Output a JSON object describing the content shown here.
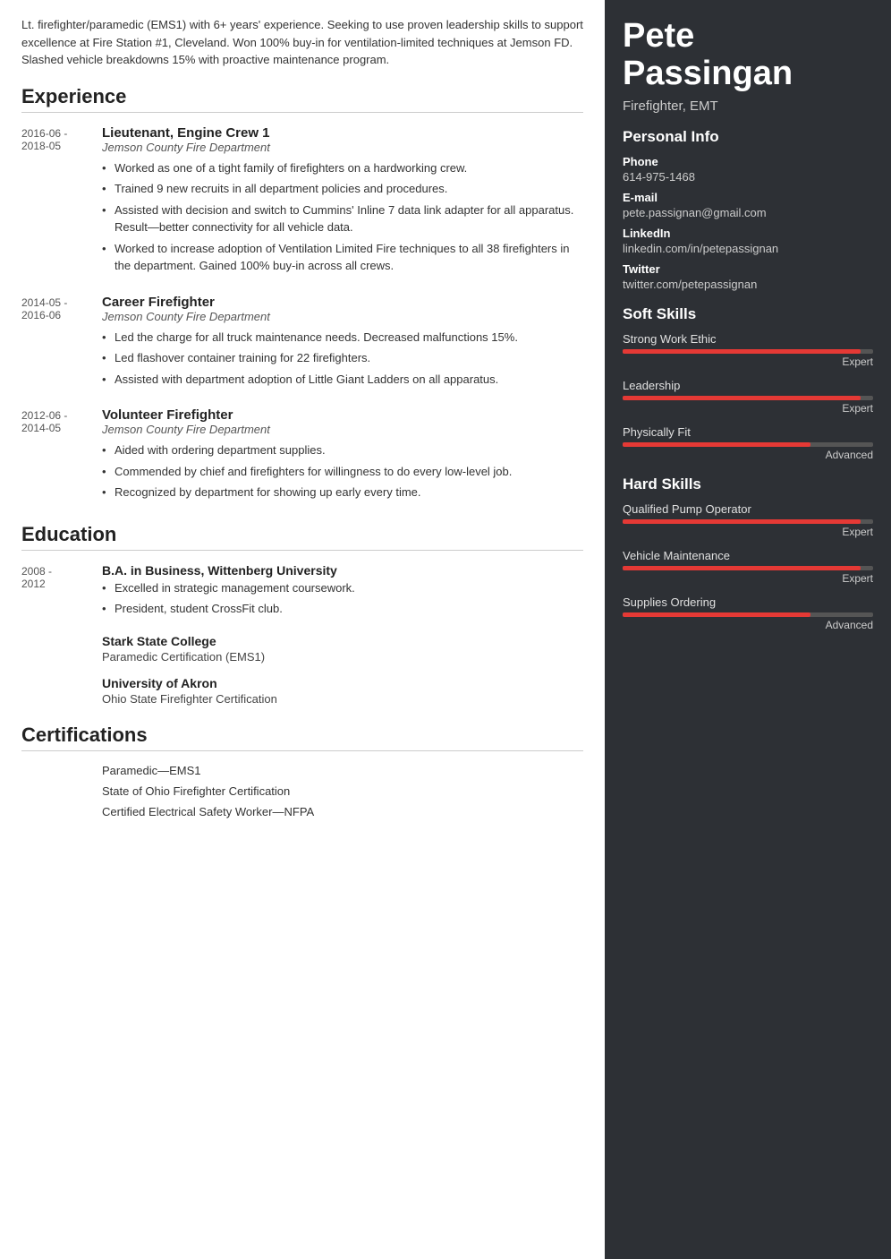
{
  "summary": "Lt. firefighter/paramedic (EMS1) with 6+ years' experience. Seeking to use proven leadership skills to support excellence at Fire Station #1, Cleveland. Won 100% buy-in for ventilation-limited techniques at Jemson FD. Slashed vehicle breakdowns 15% with proactive maintenance program.",
  "sections": {
    "experience_title": "Experience",
    "education_title": "Education",
    "certifications_title": "Certifications"
  },
  "experience": [
    {
      "dates": "2016-06 -\n2018-05",
      "title": "Lieutenant, Engine Crew 1",
      "company": "Jemson County Fire Department",
      "bullets": [
        "Worked as one of a tight family of firefighters on a hardworking crew.",
        "Trained 9 new recruits in all department policies and procedures.",
        "Assisted with decision and switch to Cummins' Inline 7 data link adapter for all apparatus. Result—better connectivity for all vehicle data.",
        "Worked to increase adoption of Ventilation Limited Fire techniques to all 38 firefighters in the department. Gained 100% buy-in across all crews."
      ]
    },
    {
      "dates": "2014-05 -\n2016-06",
      "title": "Career Firefighter",
      "company": "Jemson County Fire Department",
      "bullets": [
        "Led the charge for all truck maintenance needs. Decreased malfunctions 15%.",
        "Led flashover container training for 22 firefighters.",
        "Assisted with department adoption of Little Giant Ladders on all apparatus."
      ]
    },
    {
      "dates": "2012-06 -\n2014-05",
      "title": "Volunteer Firefighter",
      "company": "Jemson County Fire Department",
      "bullets": [
        "Aided with ordering department supplies.",
        "Commended by chief and firefighters for willingness to do every low-level job.",
        "Recognized by department for showing up early every time."
      ]
    }
  ],
  "education": [
    {
      "dates": "2008 -\n2012",
      "title": "B.A. in Business, Wittenberg University",
      "bullets": [
        "Excelled in strategic management coursework.",
        "President, student CrossFit club."
      ]
    }
  ],
  "education_no_dates": [
    {
      "institution": "Stark State College",
      "sub": "Paramedic Certification (EMS1)"
    },
    {
      "institution": "University of Akron",
      "sub": "Ohio State Firefighter Certification"
    }
  ],
  "certifications": [
    "Paramedic—EMS1",
    "State of Ohio Firefighter Certification",
    "Certified Electrical Safety Worker—NFPA"
  ],
  "right": {
    "first_name": "Pete",
    "last_name": "Passingan",
    "job_title": "Firefighter, EMT",
    "personal_info_title": "Personal Info",
    "phone_label": "Phone",
    "phone": "614-975-1468",
    "email_label": "E-mail",
    "email": "pete.passignan@gmail.com",
    "linkedin_label": "LinkedIn",
    "linkedin": "linkedin.com/in/petepassignan",
    "twitter_label": "Twitter",
    "twitter": "twitter.com/petepassignan",
    "soft_skills_title": "Soft Skills",
    "soft_skills": [
      {
        "name": "Strong Work Ethic",
        "level": "Expert",
        "pct": 95
      },
      {
        "name": "Leadership",
        "level": "Expert",
        "pct": 95
      },
      {
        "name": "Physically Fit",
        "level": "Advanced",
        "pct": 75
      }
    ],
    "hard_skills_title": "Hard Skills",
    "hard_skills": [
      {
        "name": "Qualified Pump Operator",
        "level": "Expert",
        "pct": 95
      },
      {
        "name": "Vehicle Maintenance",
        "level": "Expert",
        "pct": 95
      },
      {
        "name": "Supplies Ordering",
        "level": "Advanced",
        "pct": 75
      }
    ]
  }
}
